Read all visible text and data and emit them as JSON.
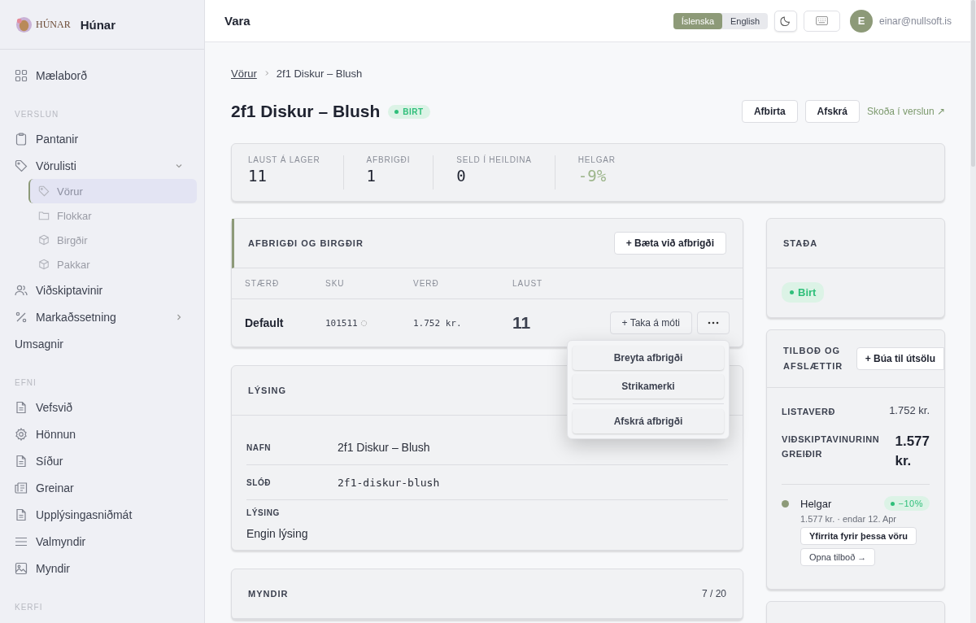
{
  "brand": {
    "logo_text": "HÚNAR",
    "name": "Húnar"
  },
  "sidebar": {
    "top": [
      {
        "label": "Mælaborð",
        "selected": false
      }
    ],
    "sections": [
      {
        "label": "VERSLUN",
        "items": [
          {
            "label": "Pantanir",
            "selected": false
          },
          {
            "label": "Vörulisti",
            "selected": false,
            "expanded": true,
            "children": [
              {
                "label": "Vörur",
                "selected": true
              },
              {
                "label": "Flokkar",
                "selected": false
              },
              {
                "label": "Birgðir",
                "selected": false
              },
              {
                "label": "Pakkar",
                "selected": false
              }
            ]
          },
          {
            "label": "Viðskiptavinir",
            "selected": false
          },
          {
            "label": "Markaðssetning",
            "selected": false,
            "expanded": false
          },
          {
            "label": "Umsagnir",
            "selected": false
          }
        ]
      },
      {
        "label": "EFNI",
        "items": [
          {
            "label": "Vefsvið",
            "selected": false
          },
          {
            "label": "Hönnun",
            "selected": false
          },
          {
            "label": "Síður",
            "selected": false
          },
          {
            "label": "Greinar",
            "selected": false
          },
          {
            "label": "Upplýsingasniðmát",
            "selected": false
          },
          {
            "label": "Valmyndir",
            "selected": false
          },
          {
            "label": "Myndir",
            "selected": false
          }
        ]
      },
      {
        "label": "KERFI"
      }
    ]
  },
  "topbar": {
    "title": "Vara",
    "languages": [
      {
        "label": "Íslenska",
        "selected": true
      },
      {
        "label": "English",
        "selected": false
      }
    ],
    "avatar": "E",
    "email": "einar@nullsoft.is"
  },
  "breadcrumb": [
    "Vörur",
    "2f1 Diskur – Blush"
  ],
  "product": {
    "title": "2f1 Diskur – Blush",
    "status": "BIRT",
    "actions": [
      "Afbirta",
      "Afskrá"
    ],
    "view_link": "Skoða í verslun ↗"
  },
  "stats": [
    {
      "label": "LAUST Á LAGER",
      "value": "11",
      "kind": "number"
    },
    {
      "label": "AFBRIGÐI",
      "value": "1",
      "kind": "number"
    },
    {
      "label": "SELD Í HEILDINA",
      "value": "0",
      "kind": "number"
    },
    {
      "label": "HELGAR",
      "value": "-9%",
      "kind": "change"
    }
  ],
  "variants": {
    "title": "AFBRIGÐI OG BIRGÐIR",
    "add_button": "+ Bæta við afbrigði",
    "columns": [
      "STÆRÐ",
      "SKU",
      "VERÐ",
      "LAUST"
    ],
    "rows": [
      {
        "size": "Default",
        "sku": "101511",
        "price": "1.752 kr.",
        "available": "11",
        "receive_button": "+ Taka á móti"
      }
    ],
    "menu": [
      {
        "label": "Breyta afbrigði",
        "divider_before": false
      },
      {
        "label": "Strikamerki",
        "divider_before": false
      },
      {
        "label": "Afskrá afbrigði",
        "divider_before": true
      }
    ]
  },
  "description": {
    "title": "LÝSING",
    "fields": [
      {
        "label": "NAFN",
        "value": "2f1 Diskur – Blush",
        "kind": "inline"
      },
      {
        "label": "SLÓÐ",
        "value": "2f1-diskur-blush",
        "kind": "mono"
      },
      {
        "label": "LÝSING",
        "value": "Engin lýsing",
        "kind": "stacked"
      }
    ]
  },
  "images": {
    "title": "MYNDIR",
    "count": "7 / 20"
  },
  "status_card": {
    "title": "STAÐA",
    "badge": "Birt"
  },
  "offers": {
    "title": "TILBOÐ OG AFSLÆTTIR",
    "create_button": "+ Búa til útsölu",
    "list_price_label": "LISTAVERÐ",
    "list_price": "1.752 kr.",
    "customer_pays_label": "VIÐSKIPTAVINURINN GREIÐIR",
    "customer_pays": "1.577 kr.",
    "items": [
      {
        "name": "Helgar",
        "color": "#8d9a78",
        "badge": "−10%",
        "detail": "1.577 kr. · endar 12. Apr",
        "override_button": "Yfirrita fyrir þessa vöru",
        "open_button": "Opna tilboð →"
      }
    ]
  }
}
